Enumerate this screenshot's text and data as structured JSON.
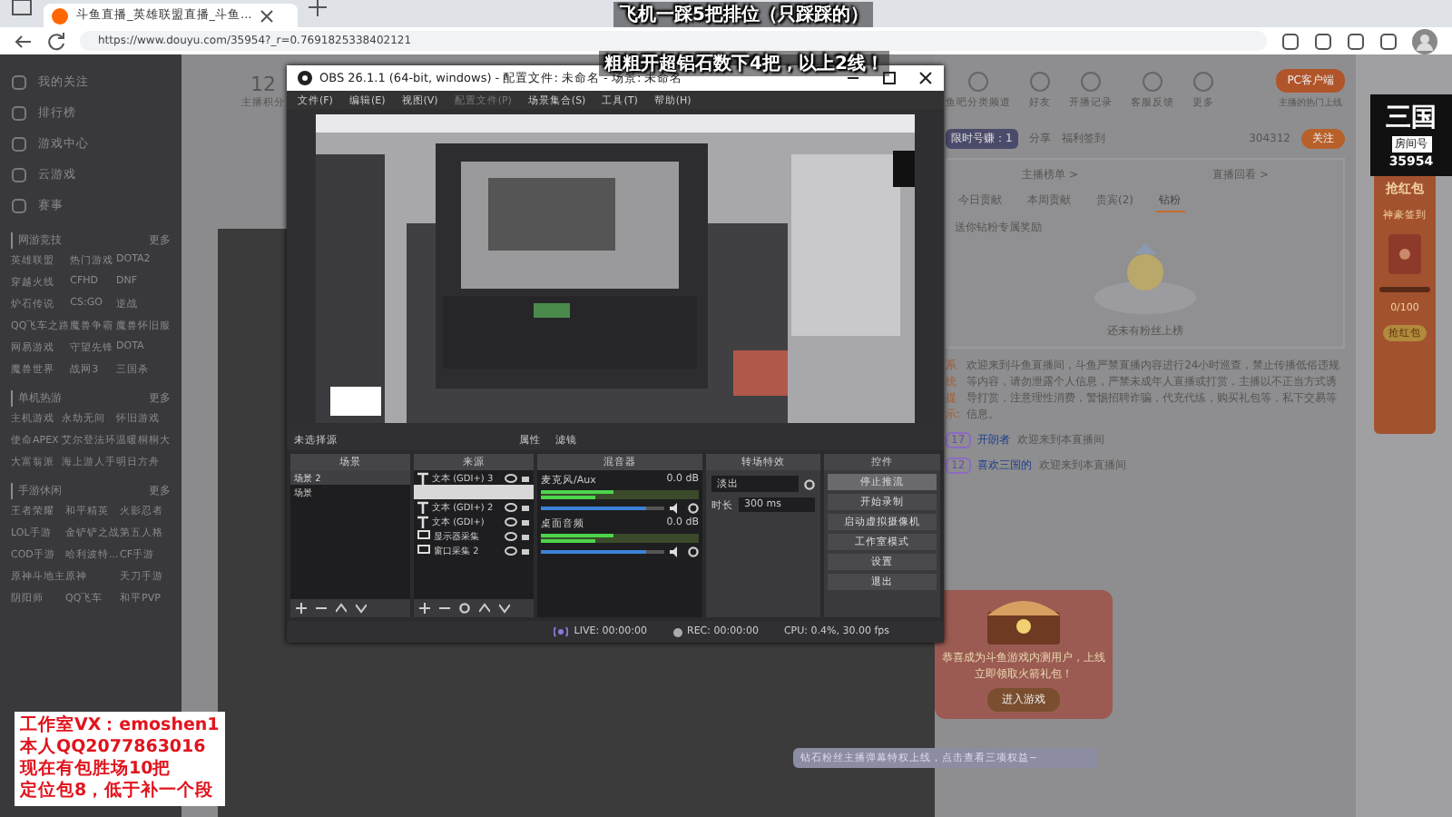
{
  "browser": {
    "tab_title": "斗鱼直播_英雄联盟直播_斗鱼...",
    "url": "https://www.douyu.com/35954?_r=0.7691825338402121"
  },
  "stream_overlay": {
    "top_lines": [
      "飞机一踩5把排位（只踩踩的）",
      "粗粗开超铝石数下4把，以上2线！"
    ],
    "logo_text": "三国",
    "room_label": "房间号",
    "room_number": "35954",
    "ad_lines": [
      "工作室VX：emoshen1",
      "本人QQ2077863016",
      "现在有包胜场10把",
      "定位包8，低于补一个段"
    ]
  },
  "sidebar": {
    "items": [
      "我的关注",
      "排行榜",
      "游戏中心",
      "云游戏",
      "赛事"
    ],
    "sections": [
      {
        "title": "网游竞技",
        "more": "更多",
        "links": [
          "英雄联盟",
          "热门游戏",
          "DOTA2",
          "穿越火线",
          "CFHD",
          "DNF",
          "炉石传说",
          "CS:GO",
          "逆战",
          "QQ飞车之路",
          "魔兽争霸",
          "魔兽怀旧服",
          "网易游戏",
          "守望先锋",
          "DOTA",
          "魔兽世界",
          "战网3",
          "三国杀"
        ]
      },
      {
        "title": "单机热游",
        "more": "更多",
        "links": [
          "主机游戏",
          "永劫无间",
          "怀旧游戏",
          "使命APEX",
          "艾尔登法环",
          "温暖桐桐大",
          "大富翁派",
          "海上游人手",
          "明日方舟"
        ]
      },
      {
        "title": "手游休闲",
        "more": "更多",
        "links": [
          "王者荣耀",
          "和平精英",
          "火影忍者",
          "LOL手游",
          "金铲铲之战",
          "第五人格",
          "COD手游",
          "哈利波特...",
          "CF手游",
          "原神斗地主",
          "原神",
          "天刀手游",
          "阴阳师",
          "QQ飞车",
          "和平PVP"
        ]
      }
    ]
  },
  "streamer": {
    "count": "12",
    "count_label": "主播积分",
    "follower_count": "304312",
    "follow_button": "关注",
    "share": "分享",
    "report": "福利签到",
    "badge": "限时号赚：1"
  },
  "header_icons": [
    {
      "label": "鱼吧分类频道"
    },
    {
      "label": "好友"
    },
    {
      "label": "开播记录"
    },
    {
      "label": "客服反馈"
    },
    {
      "label": "更多"
    }
  ],
  "client_button": "PC客户端",
  "client_caption": "主播的热门上线",
  "obs": {
    "title": "OBS 26.1.1 (64-bit, windows) - 配置文件: 未命名 - 场景: 未命名",
    "menu": [
      {
        "label": "文件(F)",
        "disabled": false
      },
      {
        "label": "编辑(E)",
        "disabled": false
      },
      {
        "label": "视图(V)",
        "disabled": false
      },
      {
        "label": "配置文件(P)",
        "disabled": true
      },
      {
        "label": "场景集合(S)",
        "disabled": false
      },
      {
        "label": "工具(T)",
        "disabled": false
      },
      {
        "label": "帮助(H)",
        "disabled": false
      }
    ],
    "no_source": "未选择源",
    "properties": "属性",
    "filters": "滤镜",
    "docks": {
      "scenes": "场景",
      "sources": "来源",
      "mixer": "混音器",
      "transitions": "转场特效",
      "controls": "控件"
    },
    "scenes": [
      {
        "name": "场景 2",
        "selected": true
      },
      {
        "name": "场景",
        "selected": false
      }
    ],
    "sources": [
      {
        "kind": "text",
        "name": "文本 (GDI+) 3",
        "selected": false
      },
      {
        "kind": "edit",
        "selected": true
      },
      {
        "kind": "text",
        "name": "文本 (GDI+) 2",
        "selected": false
      },
      {
        "kind": "text",
        "name": "文本 (GDI+)",
        "selected": false
      },
      {
        "kind": "display",
        "name": "显示器采集",
        "selected": false
      },
      {
        "kind": "display",
        "name": "窗口采集 2",
        "selected": false
      }
    ],
    "mixer": [
      {
        "name": "麦克风/Aux",
        "db": "0.0 dB",
        "level": 0.85
      },
      {
        "name": "桌面音频",
        "db": "0.0 dB",
        "level": 0.85
      }
    ],
    "transition": {
      "value": "淡出",
      "duration_label": "时长",
      "duration": "300 ms"
    },
    "controls": [
      "停止推流",
      "开始录制",
      "启动虚拟摄像机",
      "工作室模式",
      "设置",
      "退出"
    ],
    "status": {
      "live": "LIVE: 00:00:00",
      "rec": "REC: 00:00:00",
      "cpu": "CPU: 0.4%, 30.00 fps"
    }
  },
  "ranking": {
    "links": [
      "主播榜单 >",
      "直播回看 >"
    ],
    "tabs": [
      {
        "label": "今日贡献",
        "selected": false
      },
      {
        "label": "本周贡献",
        "selected": false
      },
      {
        "label": "贵宾(2)",
        "selected": false
      },
      {
        "label": "钻粉",
        "selected": true
      }
    ],
    "hint": "送你钻粉专属奖励",
    "empty": "还未有粉丝上榜"
  },
  "chat": {
    "notice_label": "系统提示:",
    "notice": "欢迎来到斗鱼直播间，斗鱼严禁直播内容进行24小时巡查，禁止传播低俗违规等内容，请勿泄露个人信息，严禁未成年人直播或打赏，主播以不正当方式诱导打赏，注意理性消费，警惕招聘诈骗，代充代练，购买礼包等，私下交易等信息。",
    "messages": [
      {
        "level": "17",
        "user": "开朗者",
        "text": "欢迎来到本直播间"
      },
      {
        "level": "12",
        "user": "喜欢三国的",
        "text": "欢迎来到本直播间"
      }
    ],
    "input_placeholder": "钻石粉丝主播弹幕特权上线，点击查看三项权益~"
  },
  "promo": {
    "text": "恭喜成为斗鱼游戏内测用户，上线立即领取火箭礼包！",
    "button": "进入游戏"
  },
  "red_envelope": {
    "title": "抢红包",
    "caption": "神豪签到",
    "progress": "0/100",
    "level": 0,
    "button": "抢红包"
  }
}
